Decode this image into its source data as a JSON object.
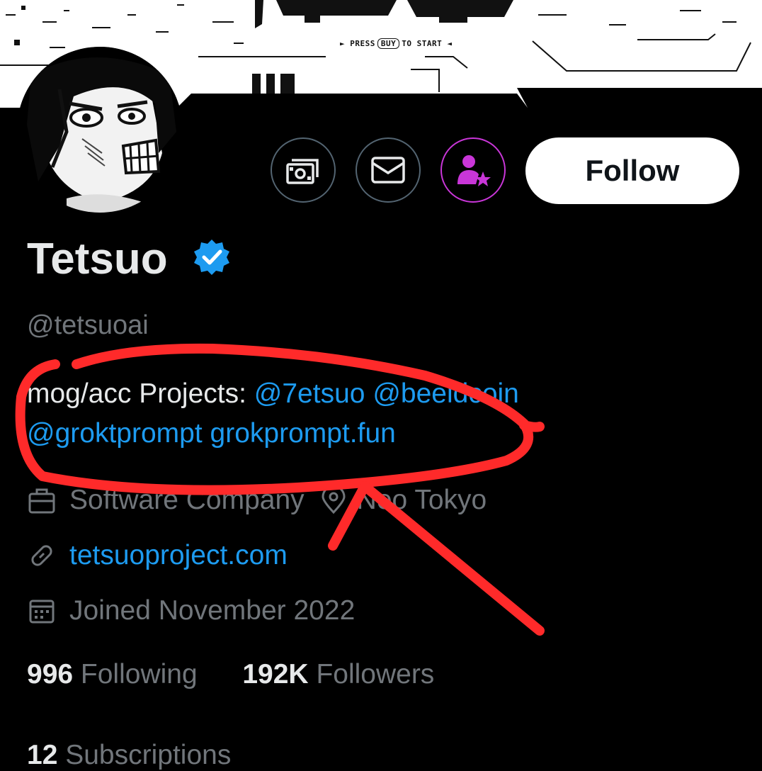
{
  "banner": {
    "press_prefix": "PRESS",
    "press_key": "BUY",
    "press_suffix": "TO START"
  },
  "actions": {
    "follow_label": "Follow"
  },
  "profile": {
    "display_name": "Tetsuo",
    "handle": "@tetsuoai",
    "bio": {
      "text": "mog/acc  Projects: ",
      "mention_1": "@7etsuo",
      "mention_2": "@beeldcoin",
      "mention_3": "@groktprompt",
      "link": "grokprompt.fun"
    },
    "category": "Software Company",
    "location": "Neo Tokyo",
    "website": "tetsuoproject.com",
    "joined": "Joined November 2022"
  },
  "stats": {
    "following_count": "996",
    "following_label": "Following",
    "followers_count": "192K",
    "followers_label": "Followers",
    "subscriptions_count": "12",
    "subscriptions_label": "Subscriptions"
  },
  "colors": {
    "background": "#000000",
    "primary_text": "#e7e9ea",
    "secondary_text": "#71767b",
    "link": "#1d9bf0",
    "verified": "#1d9bf0",
    "subscribe_accent": "#c936d8",
    "annotation": "#ff2a2a"
  }
}
